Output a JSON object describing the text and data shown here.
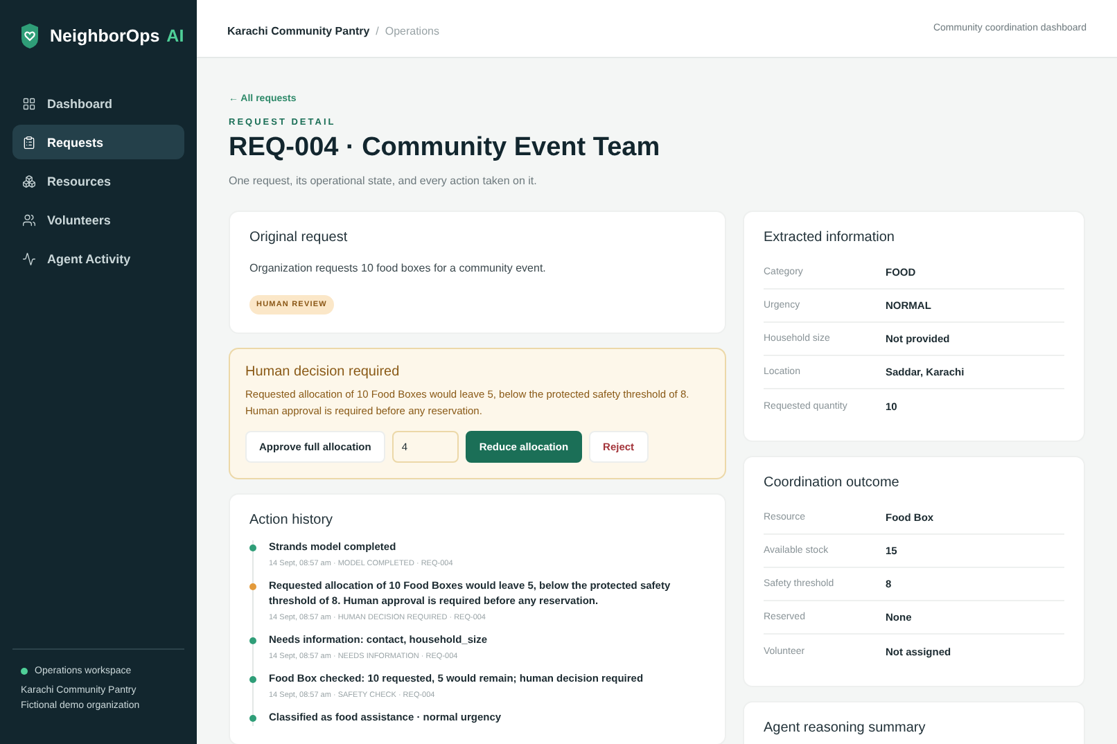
{
  "brand": {
    "name": "NeighborOps",
    "suffix": "AI"
  },
  "nav": [
    {
      "label": "Dashboard",
      "selected": false
    },
    {
      "label": "Requests",
      "selected": true
    },
    {
      "label": "Resources",
      "selected": false
    },
    {
      "label": "Volunteers",
      "selected": false
    },
    {
      "label": "Agent Activity",
      "selected": false
    }
  ],
  "workspace": {
    "status": "Operations workspace",
    "org": "Karachi Community Pantry",
    "note": "Fictional demo organization"
  },
  "header": {
    "org": "Karachi Community Pantry",
    "separator": "/",
    "section": "Operations",
    "right": "Community coordination dashboard"
  },
  "back_link": "← All requests",
  "eyebrow": "REQUEST DETAIL",
  "title": "REQ-004 · Community Event Team",
  "subtitle": "One request, its operational state, and every action taken on it.",
  "original_request": {
    "title": "Original request",
    "text": "Organization requests 10 food boxes for a community event.",
    "badge": "HUMAN REVIEW"
  },
  "decision": {
    "title": "Human decision required",
    "text": "Requested allocation of 10 Food Boxes would leave 5, below the protected safety threshold of 8. Human approval is required before any reservation.",
    "approve": "Approve full allocation",
    "quantity": "4",
    "reduce": "Reduce allocation",
    "reject": "Reject"
  },
  "history": {
    "title": "Action history",
    "items": [
      {
        "text": "Strands model completed",
        "meta": "14 Sept, 08:57 am · MODEL COMPLETED · REQ-004",
        "color": "#2f9e78"
      },
      {
        "text": "Requested allocation of 10 Food Boxes would leave 5, below the protected safety threshold of 8. Human approval is required before any reservation.",
        "meta": "14 Sept, 08:57 am · HUMAN DECISION REQUIRED · REQ-004",
        "color": "#e39a3b"
      },
      {
        "text": "Needs information: contact, household_size",
        "meta": "14 Sept, 08:57 am · NEEDS INFORMATION · REQ-004",
        "color": "#2f9e78"
      },
      {
        "text": "Food Box checked: 10 requested, 5 would remain; human decision required",
        "meta": "14 Sept, 08:57 am · SAFETY CHECK · REQ-004",
        "color": "#2f9e78"
      },
      {
        "text": "Classified as food assistance · normal urgency",
        "color": "#2f9e78"
      }
    ]
  },
  "extracted": {
    "title": "Extracted information",
    "rows": [
      {
        "label": "Category",
        "value": "FOOD"
      },
      {
        "label": "Urgency",
        "value": "NORMAL"
      },
      {
        "label": "Household size",
        "value": "Not provided"
      },
      {
        "label": "Location",
        "value": "Saddar, Karachi"
      },
      {
        "label": "Requested quantity",
        "value": "10"
      }
    ]
  },
  "outcome": {
    "title": "Coordination outcome",
    "rows": [
      {
        "label": "Resource",
        "value": "Food Box"
      },
      {
        "label": "Available stock",
        "value": "15"
      },
      {
        "label": "Safety threshold",
        "value": "8"
      },
      {
        "label": "Reserved",
        "value": "None"
      },
      {
        "label": "Volunteer",
        "value": "Not assigned"
      }
    ]
  },
  "reasoning": {
    "title": "Agent reasoning summary"
  }
}
